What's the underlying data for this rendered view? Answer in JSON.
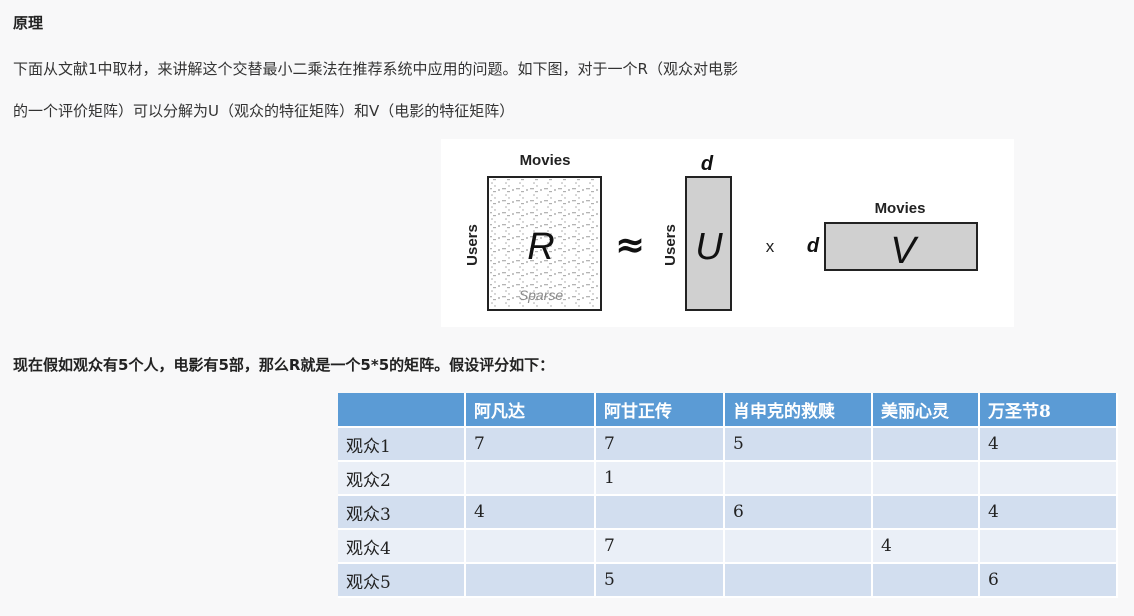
{
  "heading": "原理",
  "intro_line1": "下面从文献1中取材，来讲解这个交替最小二乘法在推荐系统中应用的问题。如下图，对于一个R（观众对电影",
  "intro_line2": "的一个评价矩阵）可以分解为U（观众的特征矩阵）和V（电影的特征矩阵）",
  "diagram": {
    "r_top_label": "Movies",
    "r_side_label": "Users",
    "r_letter": "R",
    "r_sparse": "Sparse",
    "approx": "≈",
    "u_side_label": "Users",
    "u_top_label": "d",
    "u_letter": "U",
    "times": "x",
    "v_side_label": "d",
    "v_top_label": "Movies",
    "v_letter": "V",
    "fill_color": "#d0d0d0",
    "stroke_color": "#222222"
  },
  "assumption": "现在假如观众有5个人，电影有5部，那么R就是一个5*5的矩阵。假设评分如下：",
  "table": {
    "headers": [
      "",
      "阿凡达",
      "阿甘正传",
      "肖申克的救赎",
      "美丽心灵",
      "万圣节8"
    ],
    "rows": [
      [
        "观众1",
        "7",
        "7",
        "5",
        "",
        "4"
      ],
      [
        "观众2",
        "",
        "1",
        "",
        "",
        ""
      ],
      [
        "观众3",
        "4",
        "",
        "6",
        "",
        "4"
      ],
      [
        "观众4",
        "",
        "7",
        "",
        "4",
        ""
      ],
      [
        "观众5",
        "",
        "5",
        "",
        "",
        "6"
      ]
    ],
    "header_color": "#5b9bd5",
    "row_color_odd": "#d2deef",
    "row_color_even": "#eaeff7"
  }
}
